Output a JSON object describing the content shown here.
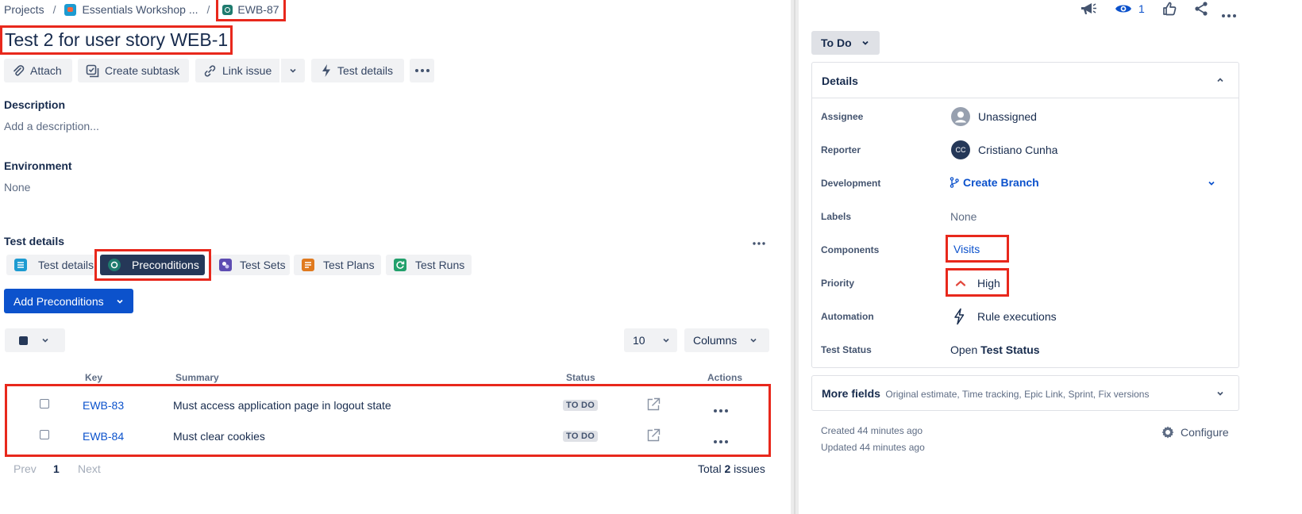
{
  "breadcrumb": {
    "projects": "Projects",
    "sep": "/",
    "project": "Essentials Workshop ...",
    "issue_key": "EWB-87"
  },
  "title": "Test 2 for user story WEB-1",
  "toolbar": {
    "attach": "Attach",
    "create_subtask": "Create subtask",
    "link_issue": "Link issue",
    "test_details": "Test details"
  },
  "description": {
    "label": "Description",
    "placeholder": "Add a description..."
  },
  "environment": {
    "label": "Environment",
    "value": "None"
  },
  "test_details": {
    "label": "Test details",
    "tabs": [
      {
        "label": "Test details",
        "icon": "list-icon",
        "color": "#1d9bd1"
      },
      {
        "label": "Preconditions",
        "icon": "precondition-icon",
        "color": "#1e7b6e"
      },
      {
        "label": "Test Sets",
        "icon": "test-set-icon",
        "color": "#5e4db2"
      },
      {
        "label": "Test Plans",
        "icon": "test-plan-icon",
        "color": "#e07a1f"
      },
      {
        "label": "Test Runs",
        "icon": "test-run-icon",
        "color": "#22a06b"
      }
    ],
    "add_button": "Add Preconditions",
    "page_size": "10",
    "columns_button": "Columns",
    "headers": {
      "key": "Key",
      "summary": "Summary",
      "status": "Status",
      "actions": "Actions"
    },
    "rows": [
      {
        "key": "EWB-83",
        "summary": "Must access application page in logout state",
        "status": "TO DO"
      },
      {
        "key": "EWB-84",
        "summary": "Must clear cookies",
        "status": "TO DO"
      }
    ],
    "pagination": {
      "prev": "Prev",
      "page": "1",
      "next": "Next"
    },
    "total": {
      "prefix": "Total",
      "count": "2",
      "suffix": "issues"
    }
  },
  "right": {
    "watchers": "1",
    "status_button": "To Do",
    "details": {
      "header": "Details",
      "assignee": {
        "label": "Assignee",
        "value": "Unassigned"
      },
      "reporter": {
        "label": "Reporter",
        "value": "Cristiano Cunha",
        "initials": "CC"
      },
      "development": {
        "label": "Development",
        "value": "Create Branch"
      },
      "labels": {
        "label": "Labels",
        "value": "None"
      },
      "components": {
        "label": "Components",
        "value": "Visits"
      },
      "priority": {
        "label": "Priority",
        "value": "High"
      },
      "automation": {
        "label": "Automation",
        "value": "Rule executions"
      },
      "test_status": {
        "label": "Test Status",
        "value_prefix": "Open",
        "value_bold": "Test Status"
      }
    },
    "more_fields": {
      "label": "More fields",
      "hint": "Original estimate, Time tracking, Epic Link, Sprint, Fix versions"
    },
    "created": "Created 44 minutes ago",
    "updated": "Updated 44 minutes ago",
    "configure": "Configure"
  },
  "colors": {
    "highlight": "#e8281c",
    "primary": "#0c52cc",
    "priority_high": "#e2483d"
  }
}
